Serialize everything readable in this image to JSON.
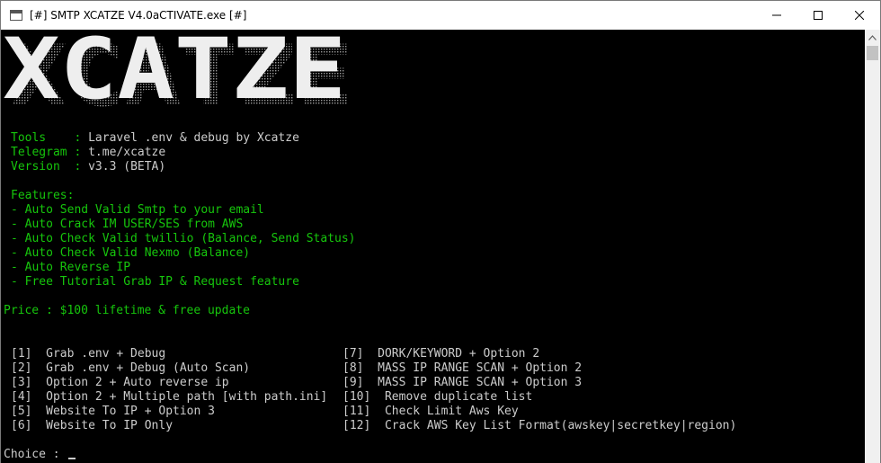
{
  "window": {
    "title": "[#] SMTP XCATZE V4.0aCTIVATE.exe [#]"
  },
  "banner": {
    "text": "XCATZE"
  },
  "info": [
    {
      "label": "Tools    ",
      "sep": ":",
      "value": "Laravel .env & debug by Xcatze"
    },
    {
      "label": "Telegram ",
      "sep": ":",
      "value": "t.me/xcatze"
    },
    {
      "label": "Version  ",
      "sep": ":",
      "value": "v3.3 (BETA)"
    }
  ],
  "features": {
    "heading": "Features:",
    "items": [
      "- Auto Send Valid Smtp to your email",
      "- Auto Crack IM USER/SES from AWS",
      "- Auto Check Valid twillio (Balance, Send Status)",
      "- Auto Check Valid Nexmo (Balance)",
      "- Auto Reverse IP",
      "- Free Tutorial Grab IP & Request feature"
    ]
  },
  "price": "Price : $100 lifetime & free update",
  "menu": {
    "left": [
      {
        "num": "[1]",
        "label": "Grab .env + Debug"
      },
      {
        "num": "[2]",
        "label": "Grab .env + Debug (Auto Scan)"
      },
      {
        "num": "[3]",
        "label": "Option 2 + Auto reverse ip"
      },
      {
        "num": "[4]",
        "label": "Option 2 + Multiple path [with path.ini]"
      },
      {
        "num": "[5]",
        "label": "Website To IP + Option 3"
      },
      {
        "num": "[6]",
        "label": "Website To IP Only"
      }
    ],
    "right": [
      {
        "num": "[7]",
        "label": "DORK/KEYWORD + Option 2"
      },
      {
        "num": "[8]",
        "label": "MASS IP RANGE SCAN + Option 2"
      },
      {
        "num": "[9]",
        "label": "MASS IP RANGE SCAN + Option 3"
      },
      {
        "num": "[10]",
        "label": "Remove duplicate list"
      },
      {
        "num": "[11]",
        "label": "Check Limit Aws Key"
      },
      {
        "num": "[12]",
        "label": "Crack AWS Key List Format(awskey|secretkey|region)"
      }
    ]
  },
  "prompt": "Choice : "
}
